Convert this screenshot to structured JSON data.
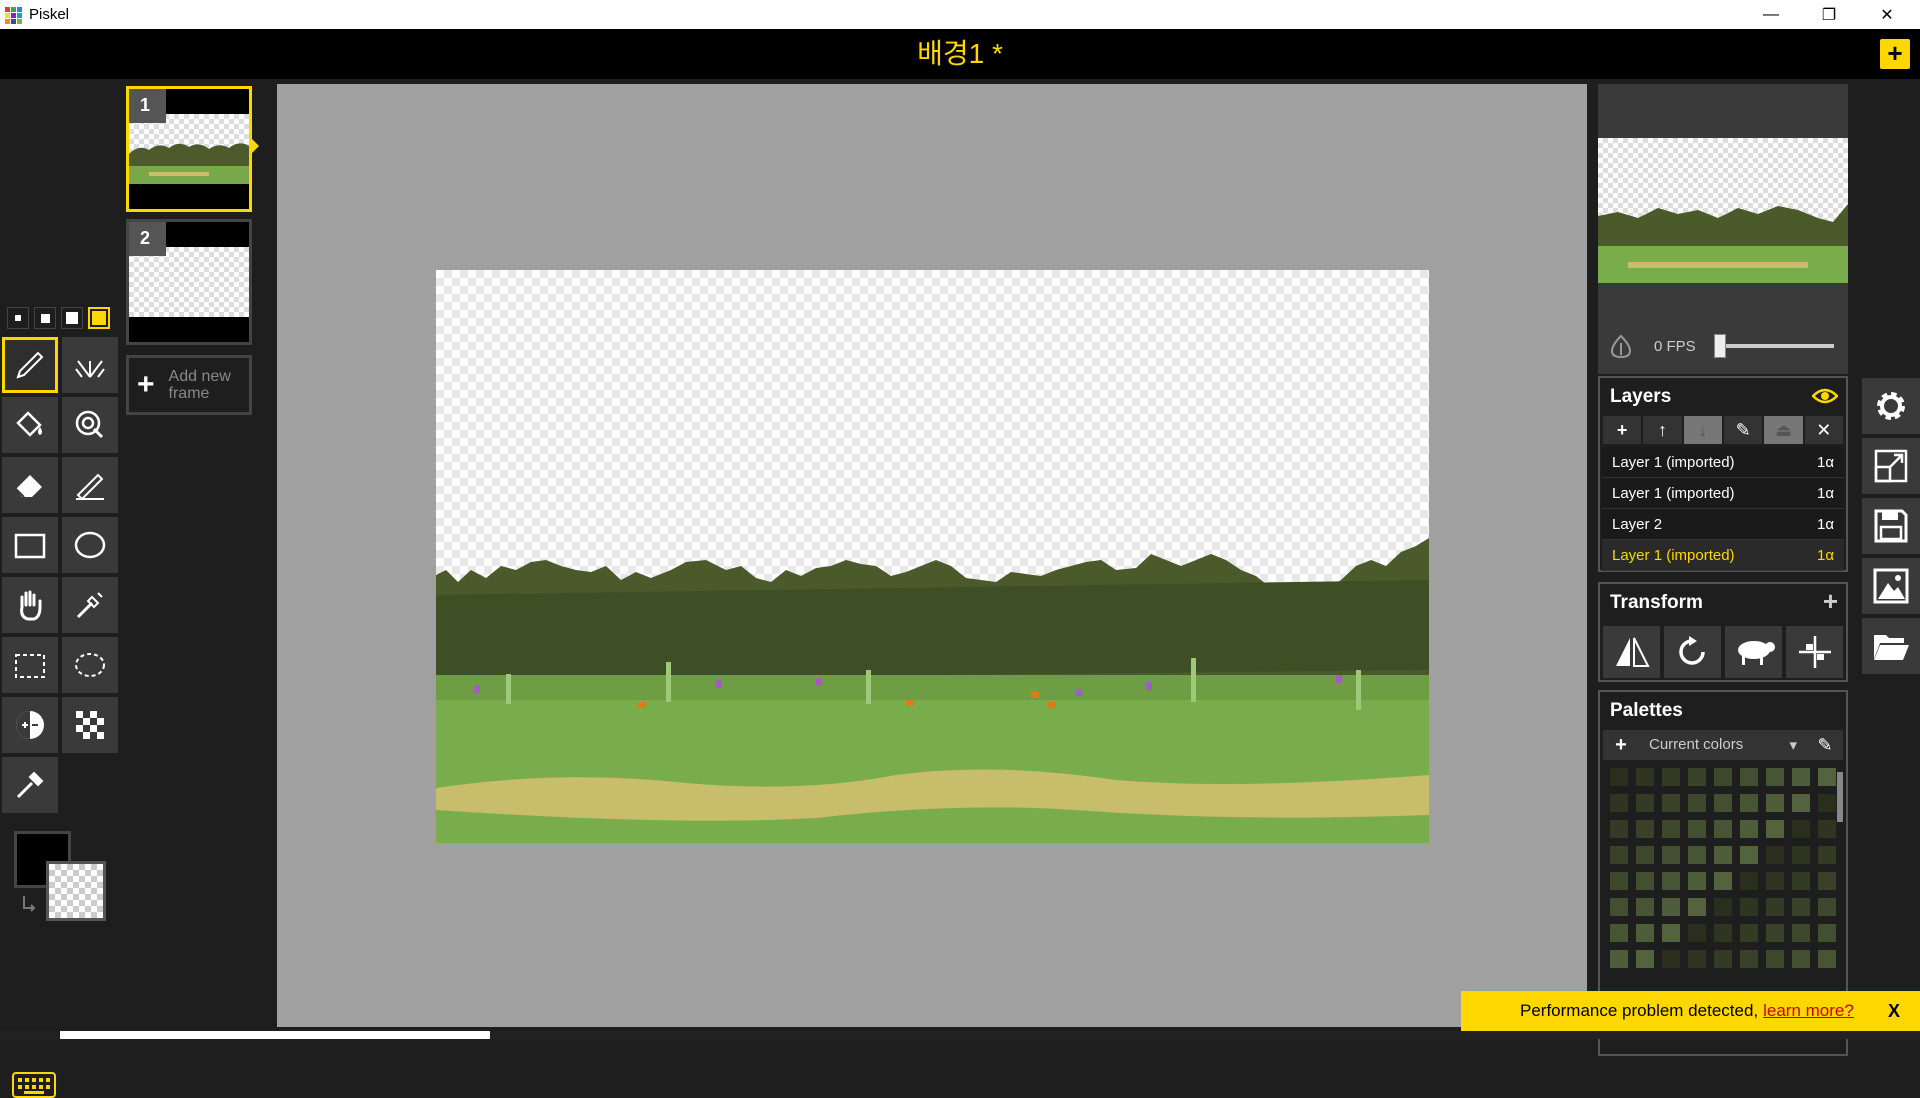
{
  "window": {
    "app_title": "Piskel",
    "minimize": "—",
    "restore": "❐",
    "close": "✕"
  },
  "header": {
    "document_title": "배경1 *",
    "new_button": "+"
  },
  "frames": {
    "items": [
      {
        "number": "1",
        "active": true
      },
      {
        "number": "2",
        "active": false
      }
    ],
    "add_icon": "+",
    "add_label": "Add new frame"
  },
  "preview": {
    "fps_label": "0 FPS",
    "fps_value": 0
  },
  "layers": {
    "title": "Layers",
    "buttons": [
      "+",
      "↑",
      "↓",
      "✎",
      "⏏",
      "✕"
    ],
    "items": [
      {
        "name": "Layer 1 (imported)",
        "opacity": "1α",
        "active": false
      },
      {
        "name": "Layer 1 (imported)",
        "opacity": "1α",
        "active": false
      },
      {
        "name": "Layer 2",
        "opacity": "1α",
        "active": false
      },
      {
        "name": "Layer 1 (imported)",
        "opacity": "1α",
        "active": true
      }
    ]
  },
  "transform": {
    "title": "Transform",
    "add": "+"
  },
  "palettes": {
    "title": "Palettes",
    "add": "+",
    "selected": "Current colors",
    "dropdown_arrow": "▾",
    "edit": "✎"
  },
  "notification": {
    "message": "Performance problem detected,",
    "link": "learn more?",
    "close": "X"
  },
  "colors": {
    "accent": "#ffd700",
    "primary_color": "#000000",
    "secondary_color": "transparent",
    "swatches": [
      "#2a2e1c",
      "#2f3520",
      "#343b24",
      "#394229",
      "#3e482d",
      "#434f31",
      "#485535",
      "#4d5c39",
      "#52633e"
    ]
  },
  "icons": {
    "tools": [
      "pen-icon",
      "vertical-mirror-pen-icon",
      "paint-bucket-icon",
      "paint-all-same-color-icon",
      "eraser-icon",
      "stroke-icon",
      "rectangle-icon",
      "circle-icon",
      "move-hand-icon",
      "shape-select-icon",
      "rectangle-select-icon",
      "lasso-select-icon",
      "lighten-icon",
      "dithering-icon",
      "color-picker-icon"
    ],
    "settings": [
      "gear-icon",
      "resize-icon",
      "save-icon",
      "export-image-icon",
      "open-folder-icon"
    ]
  }
}
